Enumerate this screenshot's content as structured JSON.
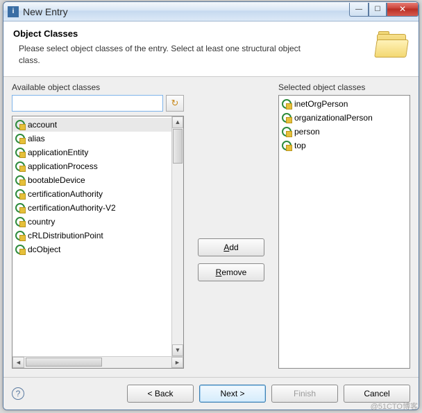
{
  "window": {
    "title": "New Entry"
  },
  "header": {
    "title": "Object Classes",
    "description": "Please select object classes of the entry. Select at least one structural object class."
  },
  "available": {
    "label": "Available object classes",
    "search_value": "",
    "items": [
      "account",
      "alias",
      "applicationEntity",
      "applicationProcess",
      "bootableDevice",
      "certificationAuthority",
      "certificationAuthority-V2",
      "country",
      "cRLDistributionPoint",
      "dcObject"
    ],
    "selected_index": 0
  },
  "actions": {
    "add": "Add",
    "remove": "Remove"
  },
  "selected": {
    "label": "Selected object classes",
    "items": [
      "inetOrgPerson",
      "organizationalPerson",
      "person",
      "top"
    ]
  },
  "footer": {
    "back": "< Back",
    "next": "Next >",
    "finish": "Finish",
    "cancel": "Cancel"
  },
  "watermark": "@51CTO博客"
}
